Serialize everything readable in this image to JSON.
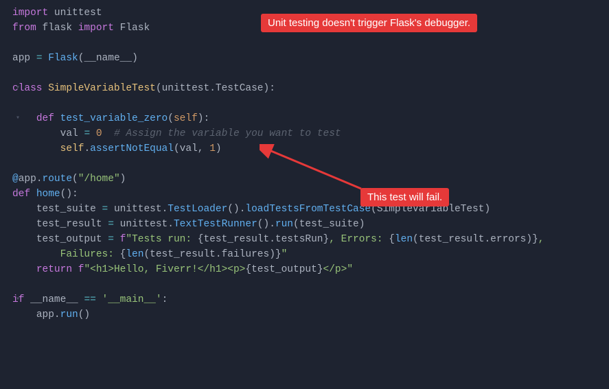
{
  "annotations": {
    "top": "Unit testing doesn't trigger Flask's debugger.",
    "middle": "This test will fail."
  },
  "code": {
    "l1": {
      "kw1": "import",
      "mod1": "unittest"
    },
    "l2": {
      "kw1": "from",
      "mod1": "flask",
      "kw2": "import",
      "cls1": "Flask"
    },
    "l4": {
      "var": "app",
      "op": "=",
      "cls": "Flask",
      "lp": "(",
      "arg": "__name__",
      "rp": ")"
    },
    "l6": {
      "kw": "class",
      "name": "SimpleVariableTest",
      "lp": "(",
      "base": "unittest",
      "dot": ".",
      "attr": "TestCase",
      "rp": "):"
    },
    "l8": {
      "kw": "def",
      "name": "test_variable_zero",
      "lp": "(",
      "param": "self",
      "rp": "):"
    },
    "l9": {
      "var": "val",
      "op": "=",
      "num": "0",
      "comment": "# Assign the variable you want to test"
    },
    "l10": {
      "self": "self",
      "dot": ".",
      "method": "assertNotEqual",
      "lp": "(",
      "arg1": "val",
      "c": ",",
      "arg2": "1",
      "rp": ")"
    },
    "l12": {
      "at": "@",
      "obj": "app",
      "dot": ".",
      "method": "route",
      "lp": "(",
      "str": "\"/home\"",
      "rp": ")"
    },
    "l13": {
      "kw": "def",
      "name": "home",
      "lp": "(",
      "rp": "):"
    },
    "l14": {
      "var": "test_suite",
      "op": "=",
      "mod": "unittest",
      "d1": ".",
      "cls": "TestLoader",
      "p1": "()",
      "d2": ".",
      "m2": "loadTestsFromTestCase",
      "lp": "(",
      "arg": "SimpleVariableTest",
      "rp": ")"
    },
    "l15": {
      "var": "test_result",
      "op": "=",
      "mod": "unittest",
      "d1": ".",
      "cls": "TextTestRunner",
      "p1": "()",
      "d2": ".",
      "m2": "run",
      "lp": "(",
      "arg": "test_suite",
      "rp": ")"
    },
    "l16": {
      "var": "test_output",
      "op": "=",
      "f": "f",
      "q1": "\"",
      "s1": "Tests run: ",
      "lb1": "{",
      "e1a": "test_result",
      "e1d": ".",
      "e1b": "testsRun",
      "rb1": "}",
      "s2": ", Errors: ",
      "lb2": "{",
      "len": "len",
      "lp": "(",
      "e2a": "test_result",
      "e2d": ".",
      "e2b": "errors",
      "rp": ")",
      "rb2": "}",
      "s3": ", "
    },
    "l17": {
      "s1": "Failures: ",
      "lb": "{",
      "len": "len",
      "lp": "(",
      "ea": "test_result",
      "ed": ".",
      "eb": "failures",
      "rp": ")",
      "rb": "}",
      "q": "\""
    },
    "l18": {
      "kw": "return",
      "f": "f",
      "q1": "\"",
      "s1": "<h1>Hello, Fiverr!</h1><p>",
      "lb": "{",
      "e": "test_output",
      "rb": "}",
      "s2": "</p>",
      "q2": "\""
    },
    "l20": {
      "kw": "if",
      "var": "__name__",
      "op": "==",
      "str": "'__main__'",
      "colon": ":"
    },
    "l21": {
      "obj": "app",
      "dot": ".",
      "method": "run",
      "p": "()"
    }
  }
}
